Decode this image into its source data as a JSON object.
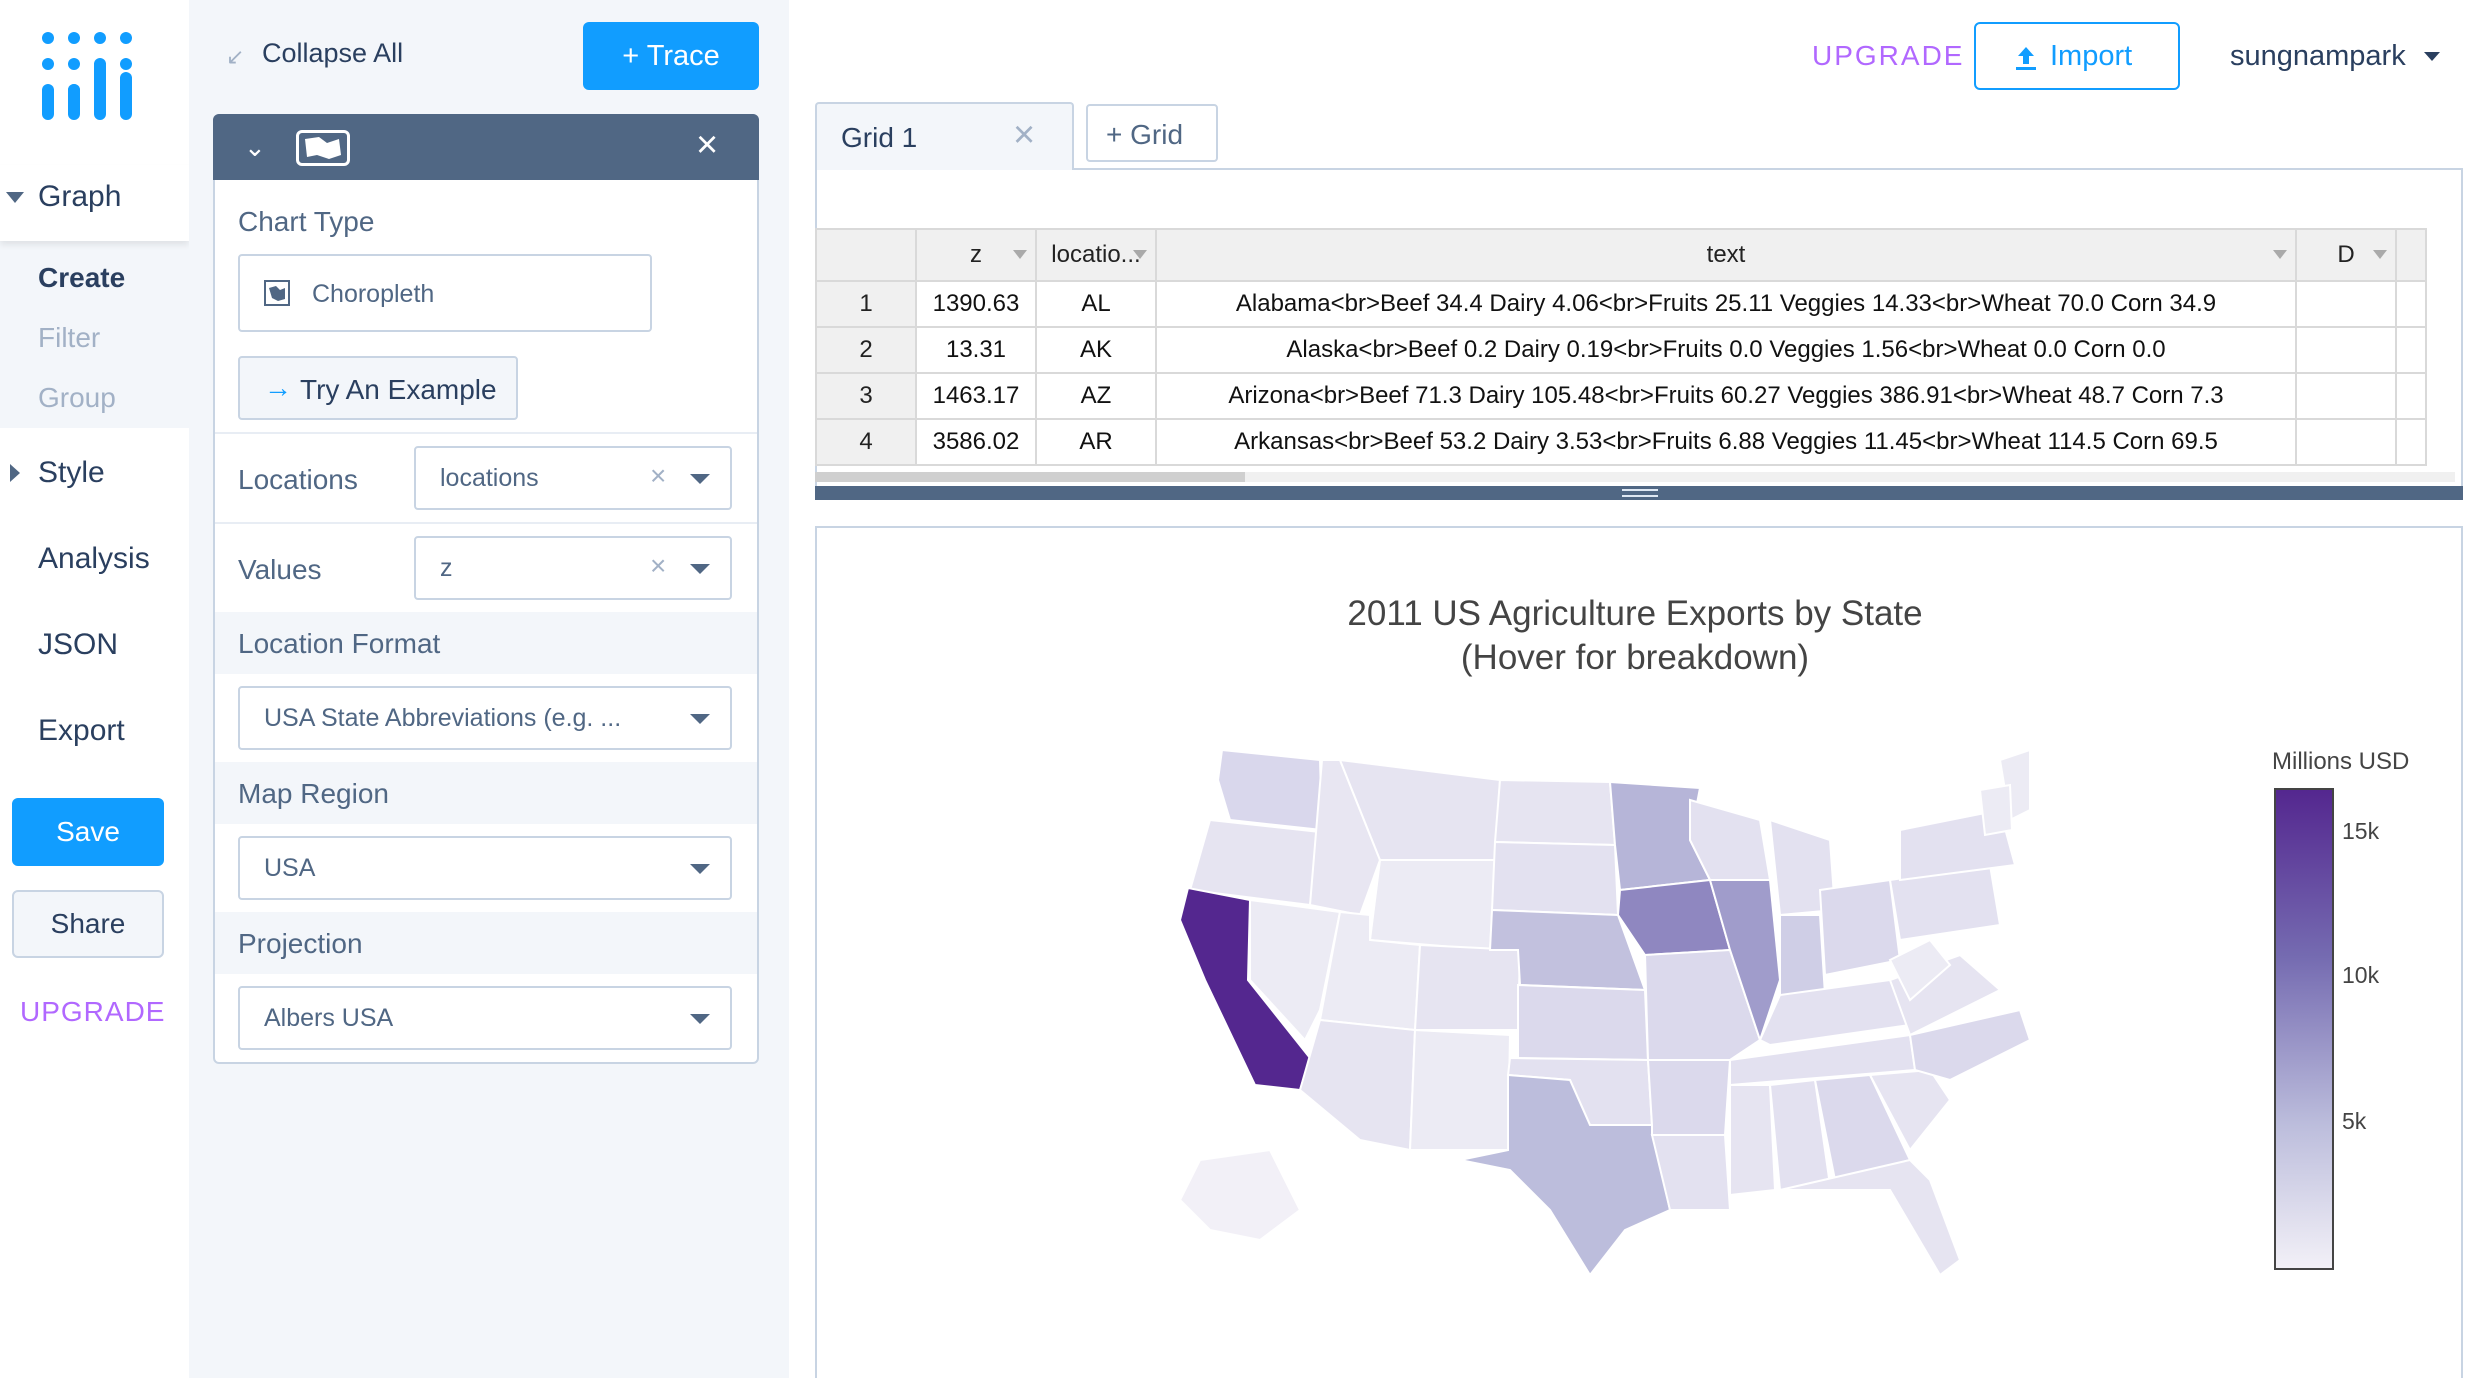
{
  "nav": {
    "sections": {
      "graph": "Graph",
      "style": "Style",
      "analysis": "Analysis",
      "json": "JSON",
      "export": "Export"
    },
    "graph_items": [
      "Create",
      "Filter",
      "Group"
    ],
    "save": "Save",
    "share": "Share",
    "upgrade": "UPGRADE"
  },
  "panel": {
    "collapse_all": "Collapse All",
    "add_trace": "+ Trace",
    "chart_type_label": "Chart Type",
    "chart_type_value": "Choropleth",
    "try_example": "Try An Example",
    "locations_label": "Locations",
    "locations_value": "locations",
    "values_label": "Values",
    "values_value": "z",
    "location_format_label": "Location Format",
    "location_format_value": "USA State Abbreviations (e.g. ...",
    "map_region_label": "Map Region",
    "map_region_value": "USA",
    "projection_label": "Projection",
    "projection_value": "Albers USA"
  },
  "header": {
    "upgrade": "UPGRADE",
    "import": "Import",
    "username": "sungnampark"
  },
  "tabs": {
    "grid1": "Grid 1",
    "add_grid": "+ Grid"
  },
  "grid": {
    "columns": [
      "z",
      "locatio...",
      "text",
      "D"
    ],
    "rows": [
      {
        "n": "1",
        "z": "1390.63",
        "loc": "AL",
        "text": "Alabama<br>Beef 34.4 Dairy 4.06<br>Fruits 25.11 Veggies 14.33<br>Wheat 70.0 Corn 34.9"
      },
      {
        "n": "2",
        "z": "13.31",
        "loc": "AK",
        "text": "Alaska<br>Beef 0.2 Dairy 0.19<br>Fruits 0.0 Veggies 1.56<br>Wheat 0.0 Corn 0.0"
      },
      {
        "n": "3",
        "z": "1463.17",
        "loc": "AZ",
        "text": "Arizona<br>Beef 71.3 Dairy 105.48<br>Fruits 60.27 Veggies 386.91<br>Wheat 48.7 Corn 7.3"
      },
      {
        "n": "4",
        "z": "3586.02",
        "loc": "AR",
        "text": "Arkansas<br>Beef 53.2 Dairy 3.53<br>Fruits 6.88 Veggies 11.45<br>Wheat 114.5 Corn 69.5"
      }
    ]
  },
  "plot": {
    "title_line1": "2011 US Agriculture Exports by State",
    "title_line2": "(Hover for breakdown)",
    "colorbar_title": "Millions USD",
    "colorbar_ticks": [
      "15k",
      "10k",
      "5k"
    ],
    "colorscale": [
      "#f2f0f7",
      "#bcbddc",
      "#756bb1",
      "#54278f"
    ],
    "highlighted_states": {
      "CA": "#54278f",
      "IA": "#8f87c0",
      "IL": "#a09ccb",
      "TX": "#bcbddc",
      "MN": "#b6b5d8",
      "NE": "#c2c1de"
    }
  },
  "colors": {
    "accent": "#119dff",
    "upgrade": "#b168ff",
    "header_bar": "#506784"
  }
}
